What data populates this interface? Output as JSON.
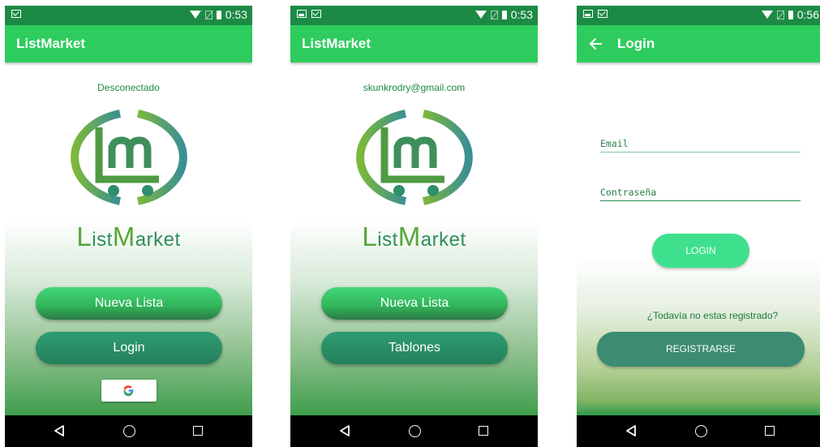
{
  "theme": {
    "status_bar": "#1c8a44",
    "app_bar": "#2ecc5e",
    "primary_button": "#3ddc84",
    "secondary_button": "#258260",
    "nav_bar": "#000000"
  },
  "screens": [
    {
      "status_bar": {
        "left_icons": [
          "mail-icon"
        ],
        "time": "0:53"
      },
      "app_bar": {
        "title": "ListMarket"
      },
      "status_text": "Desconectado",
      "brand": {
        "first_letter": "L",
        "part1": "ist",
        "big_letter": "M",
        "part2": "arket"
      },
      "buttons": {
        "primary": "Nueva Lista",
        "secondary": "Login"
      },
      "google_button": {
        "icon": "google-g-icon"
      }
    },
    {
      "status_bar": {
        "left_icons": [
          "image-icon",
          "mail-icon"
        ],
        "time": "0:53"
      },
      "app_bar": {
        "title": "ListMarket"
      },
      "status_text": "skunkrodry@gmail.com",
      "brand": {
        "first_letter": "L",
        "part1": "ist",
        "big_letter": "M",
        "part2": "arket"
      },
      "buttons": {
        "primary": "Nueva Lista",
        "secondary": "Tablones"
      }
    },
    {
      "status_bar": {
        "left_icons": [
          "image-icon",
          "mail-icon"
        ],
        "time": "0:56"
      },
      "app_bar": {
        "title": "Login",
        "back_icon": "arrow-left-icon"
      },
      "fields": {
        "email_label": "Email",
        "password_label": "Contraseña"
      },
      "login_button": "LOGIN",
      "register_prompt": "¿Todavía no estas registrado?",
      "register_button": "REGISTRARSE"
    }
  ]
}
